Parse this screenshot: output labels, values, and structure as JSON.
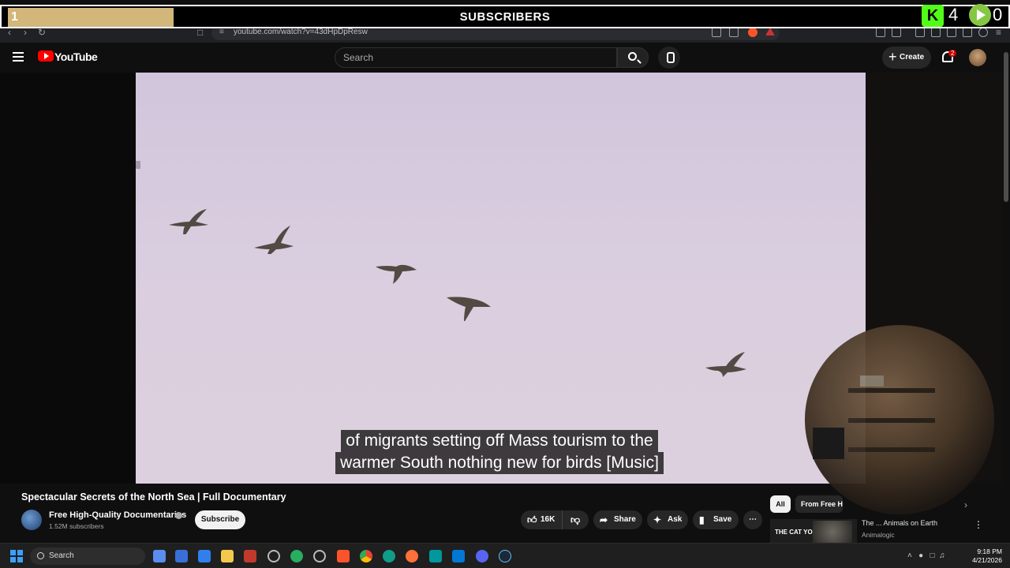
{
  "stream_overlay": {
    "goal_number": "1",
    "title": "SUBSCRIBERS",
    "kick_label": "K",
    "kick_count": "4",
    "rumble_count": "0"
  },
  "browser": {
    "url": "youtube.com/watch?v=43dHpDpResw"
  },
  "header": {
    "logo_text": "YouTube",
    "search_placeholder": "Search",
    "create_label": "Create",
    "notification_count": "2"
  },
  "video": {
    "caption_line1": "of migrants setting off Mass tourism to the",
    "caption_line2": "warmer South nothing new for birds [Music]"
  },
  "watch": {
    "title": "Spectacular Secrets of the North Sea | Full Documentary",
    "channel_name": "Free High-Quality Documentaries",
    "subscribers": "1.52M subscribers",
    "subscribe_label": "Subscribe",
    "likes": "16K",
    "share_label": "Share",
    "ask_label": "Ask",
    "save_label": "Save"
  },
  "sidebar": {
    "chip_all": "All",
    "chip_from": "From Free H",
    "rec_thumb_text": "THE CAT YOU",
    "rec_title": "The ... Animals on Earth",
    "rec_channel": "Animalogic"
  },
  "taskbar": {
    "search_label": "Search",
    "time": "9:18 PM",
    "date": "4/21/2026"
  },
  "colors": {
    "youtube_red": "#ff0000",
    "kick_green": "#53fc18",
    "rumble_green": "#85c742",
    "overlay_progress": "#d2b67a"
  }
}
